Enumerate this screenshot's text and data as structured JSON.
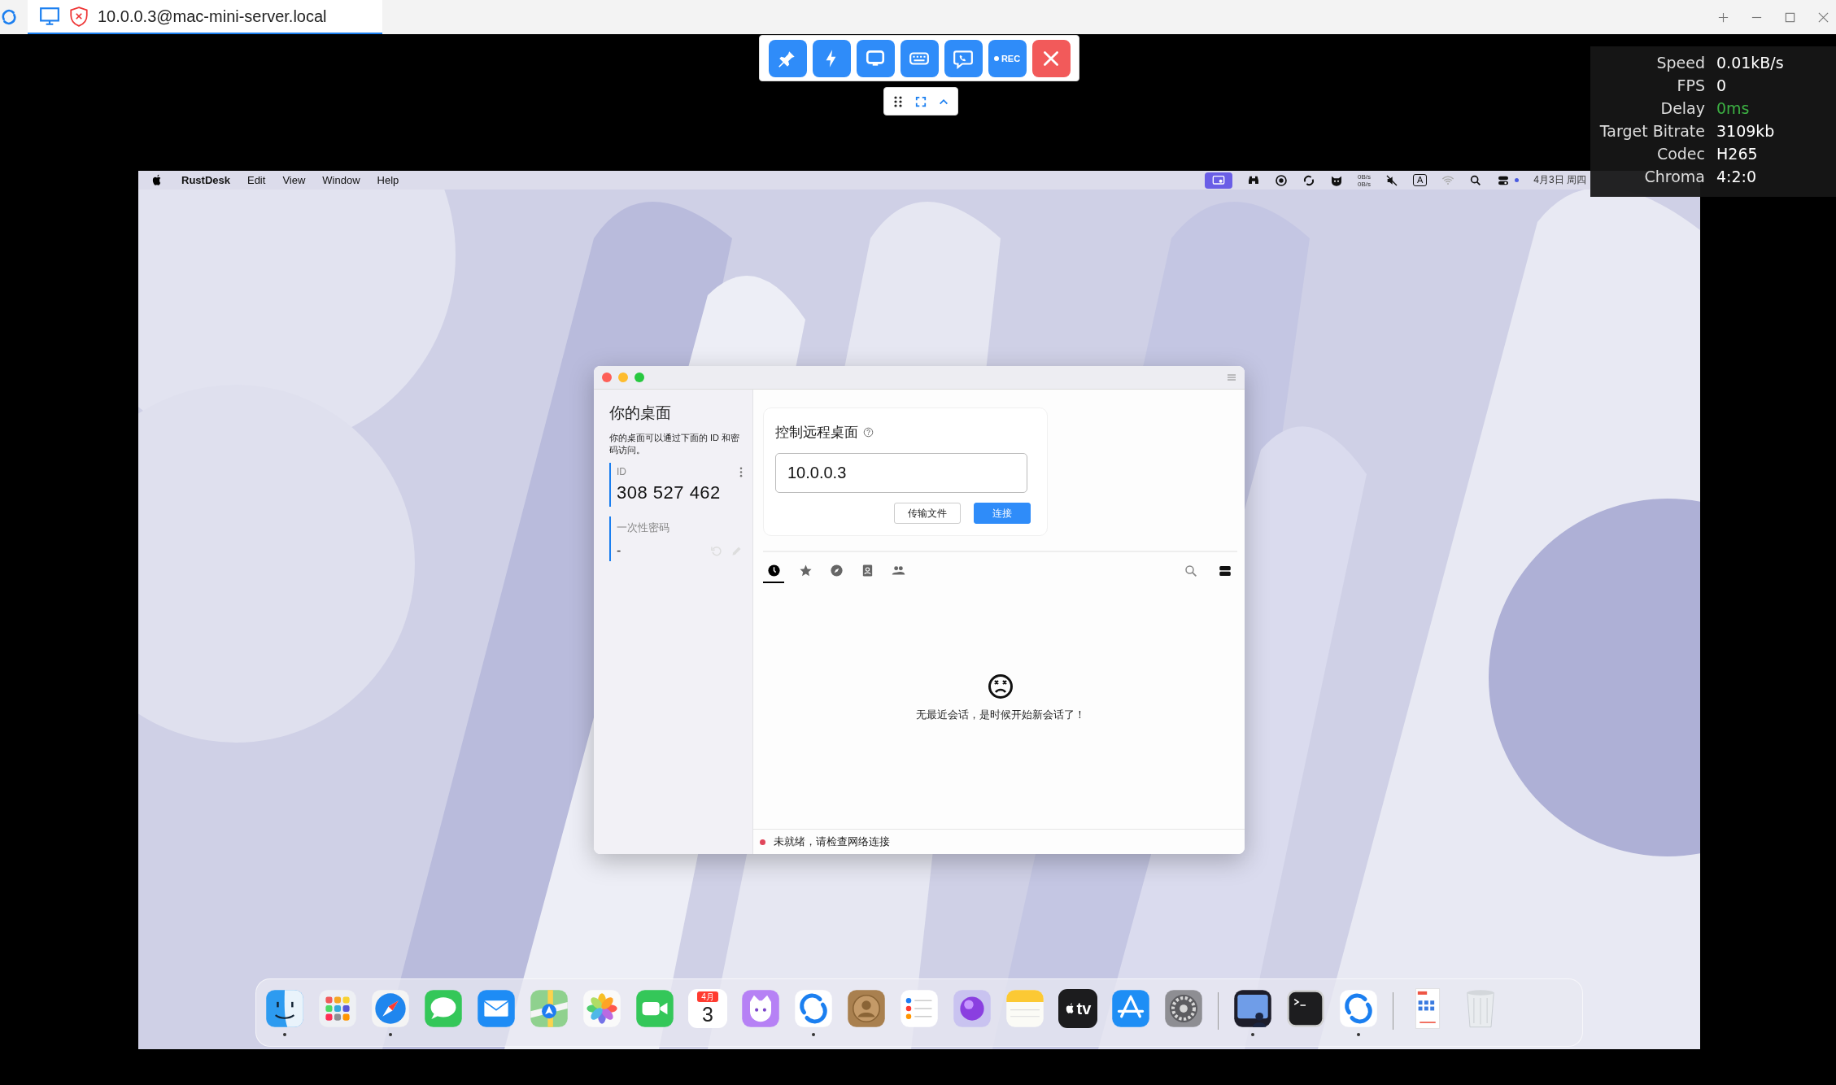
{
  "app_tab": {
    "title": "10.0.0.3@mac-mini-server.local",
    "selected": true
  },
  "toolbar": {
    "buttons": [
      {
        "kind": "pin"
      },
      {
        "kind": "action"
      },
      {
        "kind": "display"
      },
      {
        "kind": "keyboard"
      },
      {
        "kind": "chat"
      },
      {
        "kind": "record",
        "label": "REC"
      },
      {
        "kind": "close"
      }
    ]
  },
  "stats": [
    {
      "label": "Speed",
      "value": "0.01kB/s",
      "color": "#ffffff"
    },
    {
      "label": "FPS",
      "value": "0",
      "color": "#ffffff"
    },
    {
      "label": "Delay",
      "value": "0ms",
      "color": "#3cb043"
    },
    {
      "label": "Target Bitrate",
      "value": "3109kb",
      "color": "#ffffff"
    },
    {
      "label": "Codec",
      "value": "H265",
      "color": "#ffffff"
    },
    {
      "label": "Chroma",
      "value": "4:2:0",
      "color": "#ffffff"
    }
  ],
  "menubar": {
    "menus": [
      "RustDesk",
      "Edit",
      "View",
      "Window",
      "Help"
    ],
    "net_speed": [
      "0B/s",
      "0B/s"
    ],
    "input_source": "A",
    "date": "4月3日 周四"
  },
  "rustdesk": {
    "sidebar": {
      "title": "你的桌面",
      "description": "你的桌面可以通过下面的 ID 和密码访问。",
      "id_label": "ID",
      "id_value": "308 527 462",
      "password_label": "一次性密码",
      "password_value": "-"
    },
    "connect": {
      "title": "控制远程桌面",
      "value": "10.0.0.3",
      "buttons": [
        {
          "label": "传输文件",
          "primary": false
        },
        {
          "label": "连接",
          "primary": true
        }
      ]
    },
    "tabs": [
      {
        "kind": "recent",
        "selected": true
      },
      {
        "kind": "favorites",
        "selected": false
      },
      {
        "kind": "discovered",
        "selected": false
      },
      {
        "kind": "address_book",
        "selected": false
      },
      {
        "kind": "group",
        "selected": false
      }
    ],
    "empty_message": "无最近会话，是时候开始新会话了！",
    "status": {
      "text": "未就绪，请检查网络连接",
      "ready": false
    }
  },
  "dock": {
    "sections": [
      {
        "apps": [
          {
            "kind": "finder",
            "running": true
          },
          {
            "kind": "launchpad",
            "running": false
          },
          {
            "kind": "safari",
            "running": true
          },
          {
            "kind": "messages",
            "running": false
          },
          {
            "kind": "mail",
            "running": false
          },
          {
            "kind": "maps",
            "running": false
          },
          {
            "kind": "photos",
            "running": false
          },
          {
            "kind": "facetime",
            "running": false
          },
          {
            "kind": "calendar",
            "running": false,
            "month": "4月",
            "day": "3"
          },
          {
            "kind": "cat",
            "running": false
          },
          {
            "kind": "rustdesk",
            "running": true
          },
          {
            "kind": "contacts",
            "running": false
          },
          {
            "kind": "reminders",
            "running": false
          },
          {
            "kind": "orb",
            "running": false
          },
          {
            "kind": "notes",
            "running": false
          },
          {
            "kind": "tv",
            "running": false,
            "label": "tv"
          },
          {
            "kind": "appstore",
            "running": false
          },
          {
            "kind": "settings",
            "running": false
          }
        ]
      },
      {
        "apps": [
          {
            "kind": "screen",
            "running": true
          },
          {
            "kind": "terminal",
            "running": false
          },
          {
            "kind": "rustdesk",
            "running": true
          }
        ]
      },
      {
        "apps": [
          {
            "kind": "document",
            "running": false
          },
          {
            "kind": "trash",
            "running": false
          }
        ]
      }
    ]
  }
}
